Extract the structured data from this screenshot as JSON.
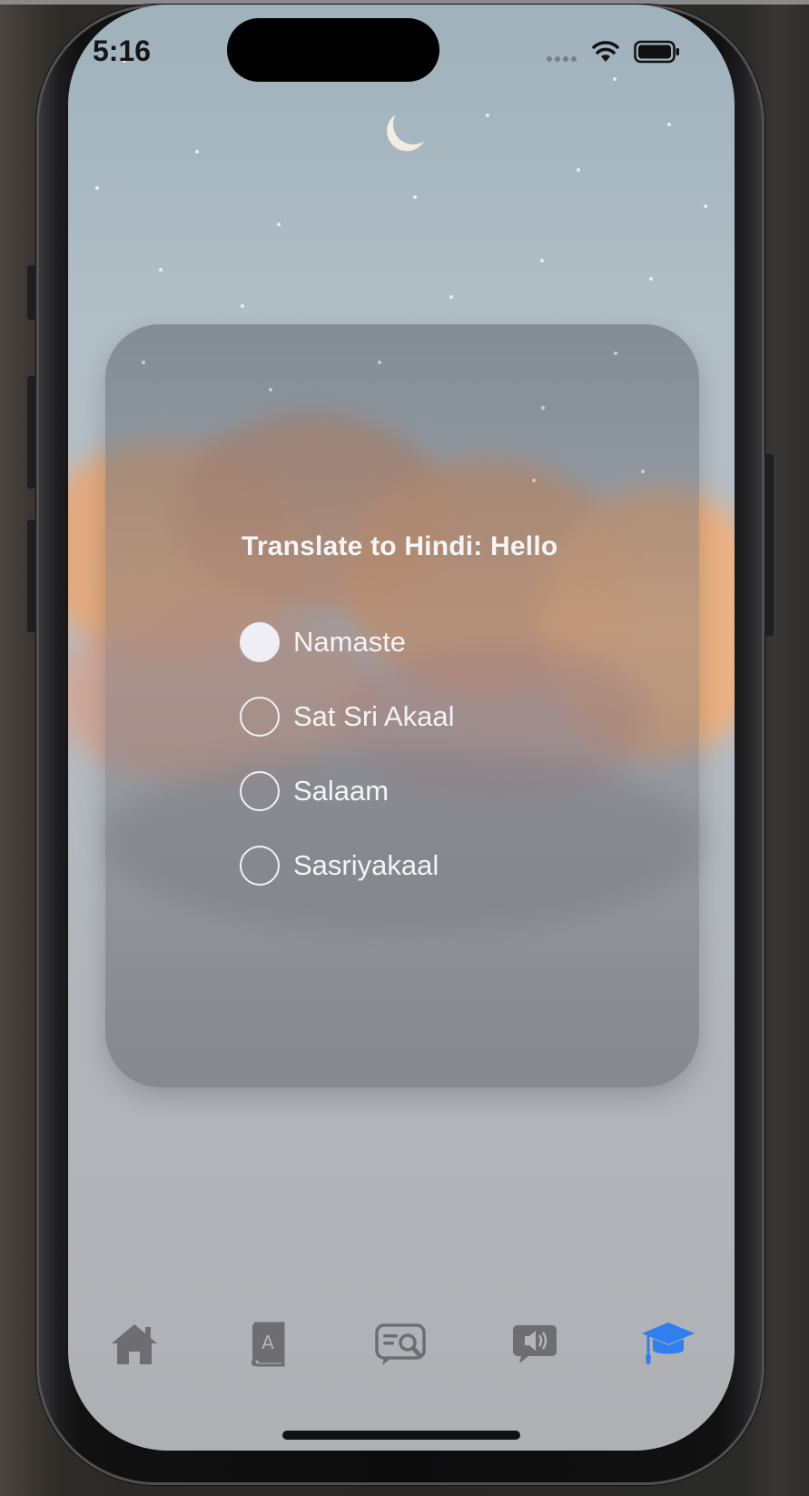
{
  "status_bar": {
    "time": "5:16",
    "icons": [
      "cellular-dots-icon",
      "wifi-icon",
      "battery-icon"
    ]
  },
  "quiz": {
    "question": "Translate to Hindi: Hello",
    "options": [
      {
        "label": "Namaste",
        "selected": true
      },
      {
        "label": "Sat Sri Akaal",
        "selected": false
      },
      {
        "label": "Salaam",
        "selected": false
      },
      {
        "label": "Sasriyakaal",
        "selected": false
      }
    ]
  },
  "tab_bar": {
    "tabs": [
      {
        "icon": "home-icon",
        "active": false
      },
      {
        "icon": "dictionary-book-icon",
        "active": false
      },
      {
        "icon": "search-chat-icon",
        "active": false
      },
      {
        "icon": "speaker-bubble-icon",
        "active": false
      },
      {
        "icon": "graduation-cap-icon",
        "active": true
      }
    ],
    "active_color": "#2f7ff0",
    "inactive_color": "#6e6e72"
  }
}
